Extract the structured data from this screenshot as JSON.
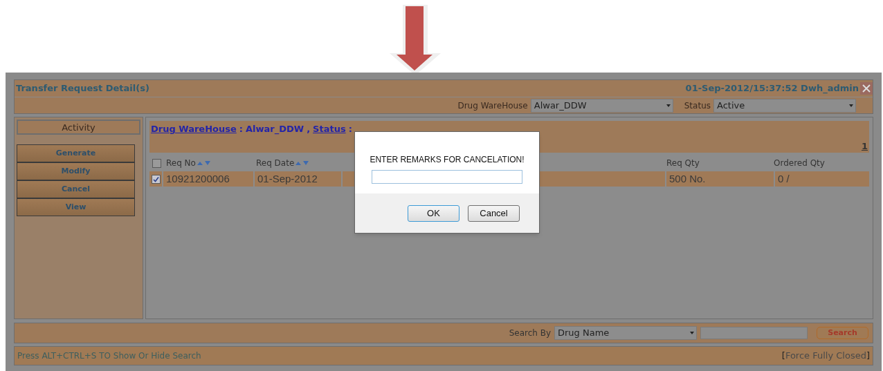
{
  "window": {
    "title": "Transfer Request Detail(s)",
    "datetime_user": "01-Sep-2012/15:37:52 Dwh_admin"
  },
  "filters": [
    {
      "label": "Drug WareHouse",
      "value": "Alwar_DDW"
    },
    {
      "label": "Status",
      "value": "Active"
    }
  ],
  "sidebar": {
    "heading": "Activity",
    "buttons": [
      "Generate",
      "Modify",
      "Cancel",
      "View"
    ]
  },
  "breadcrumb": [
    {
      "label": "Drug WareHouse",
      "separator": ":",
      "value": "Alwar_DDW",
      "joiner": ","
    },
    {
      "label": "Status",
      "separator": ":"
    }
  ],
  "pagination": "1",
  "table": {
    "header_checked": false,
    "columns": [
      {
        "label": "Req No",
        "sortable": true
      },
      {
        "label": "Req Date",
        "sortable": true
      },
      {
        "label": "Req Qty",
        "sortable": false
      },
      {
        "label": "Ordered Qty",
        "sortable": false
      }
    ],
    "rows": [
      {
        "checked": true,
        "cells": [
          "10921200006",
          "01-Sep-2012",
          "500 No.",
          "0 /"
        ]
      }
    ]
  },
  "search": {
    "label": "Search By",
    "select": "Drug Name",
    "button": "Search"
  },
  "footer": {
    "hint": "Press ALT+CTRL+S TO Show Or Hide Search",
    "prefix": "[",
    "link": "Force Fully Closed",
    "suffix": "]"
  },
  "dialog": {
    "message": "ENTER REMARKS FOR CANCELATION!",
    "buttons": [
      {
        "label": "OK",
        "default": true
      },
      {
        "label": "Cancel",
        "default": false
      }
    ]
  }
}
